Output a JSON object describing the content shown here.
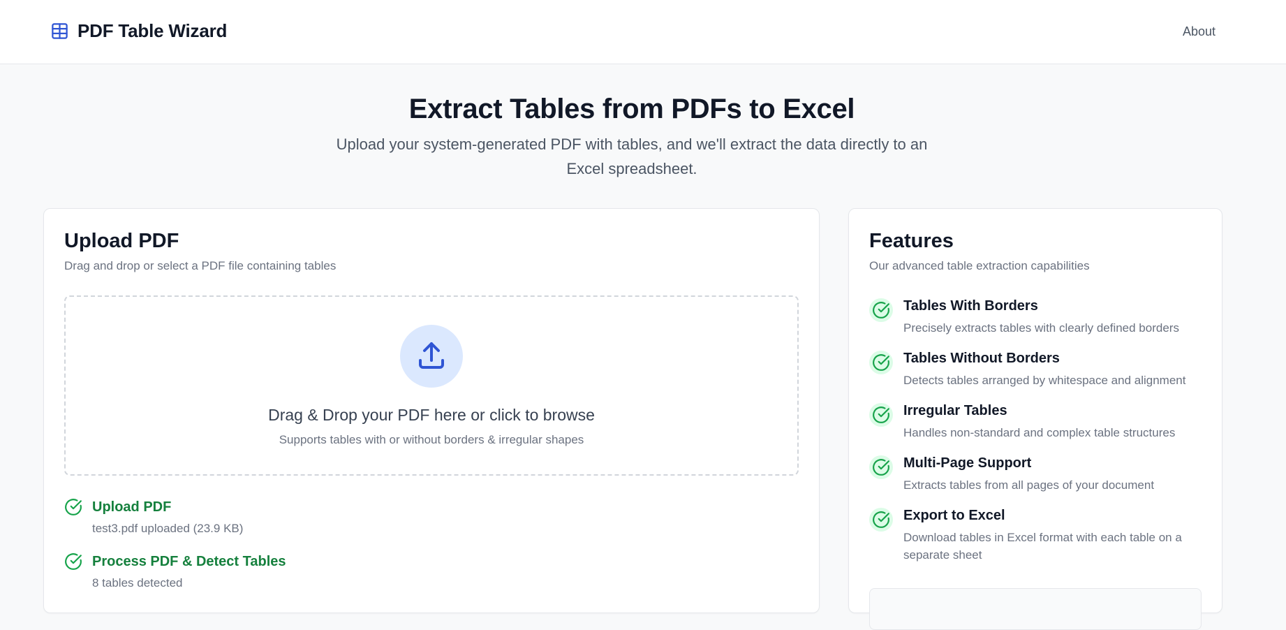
{
  "header": {
    "app_title": "PDF Table Wizard",
    "nav_about": "About",
    "logo_icon": "table-icon"
  },
  "hero": {
    "title": "Extract Tables from PDFs to Excel",
    "subtitle": "Upload your system-generated PDF with tables, and we'll extract the data directly to an Excel spreadsheet."
  },
  "upload": {
    "title": "Upload PDF",
    "description": "Drag and drop or select a PDF file containing tables",
    "dropzone_title": "Drag & Drop your PDF here or click to browse",
    "dropzone_subtitle": "Supports tables with or without borders & irregular shapes",
    "icon": "upload-icon",
    "steps": [
      {
        "title": "Upload PDF",
        "detail": "test3.pdf uploaded (23.9 KB)",
        "status": "complete"
      },
      {
        "title": "Process PDF & Detect Tables",
        "detail": "8 tables detected",
        "status": "complete"
      }
    ]
  },
  "features": {
    "title": "Features",
    "description": "Our advanced table extraction capabilities",
    "items": [
      {
        "title": "Tables With Borders",
        "description": "Precisely extracts tables with clearly defined borders"
      },
      {
        "title": "Tables Without Borders",
        "description": "Detects tables arranged by whitespace and alignment"
      },
      {
        "title": "Irregular Tables",
        "description": "Handles non-standard and complex table structures"
      },
      {
        "title": "Multi-Page Support",
        "description": "Extracts tables from all pages of your document"
      },
      {
        "title": "Export to Excel",
        "description": "Download tables in Excel format with each table on a separate sheet"
      }
    ]
  },
  "colors": {
    "accent_blue": "#2f55d4",
    "upload_circle_bg": "#dbe8fe",
    "success_green": "#16a34a",
    "success_bg": "#dcfce7"
  }
}
